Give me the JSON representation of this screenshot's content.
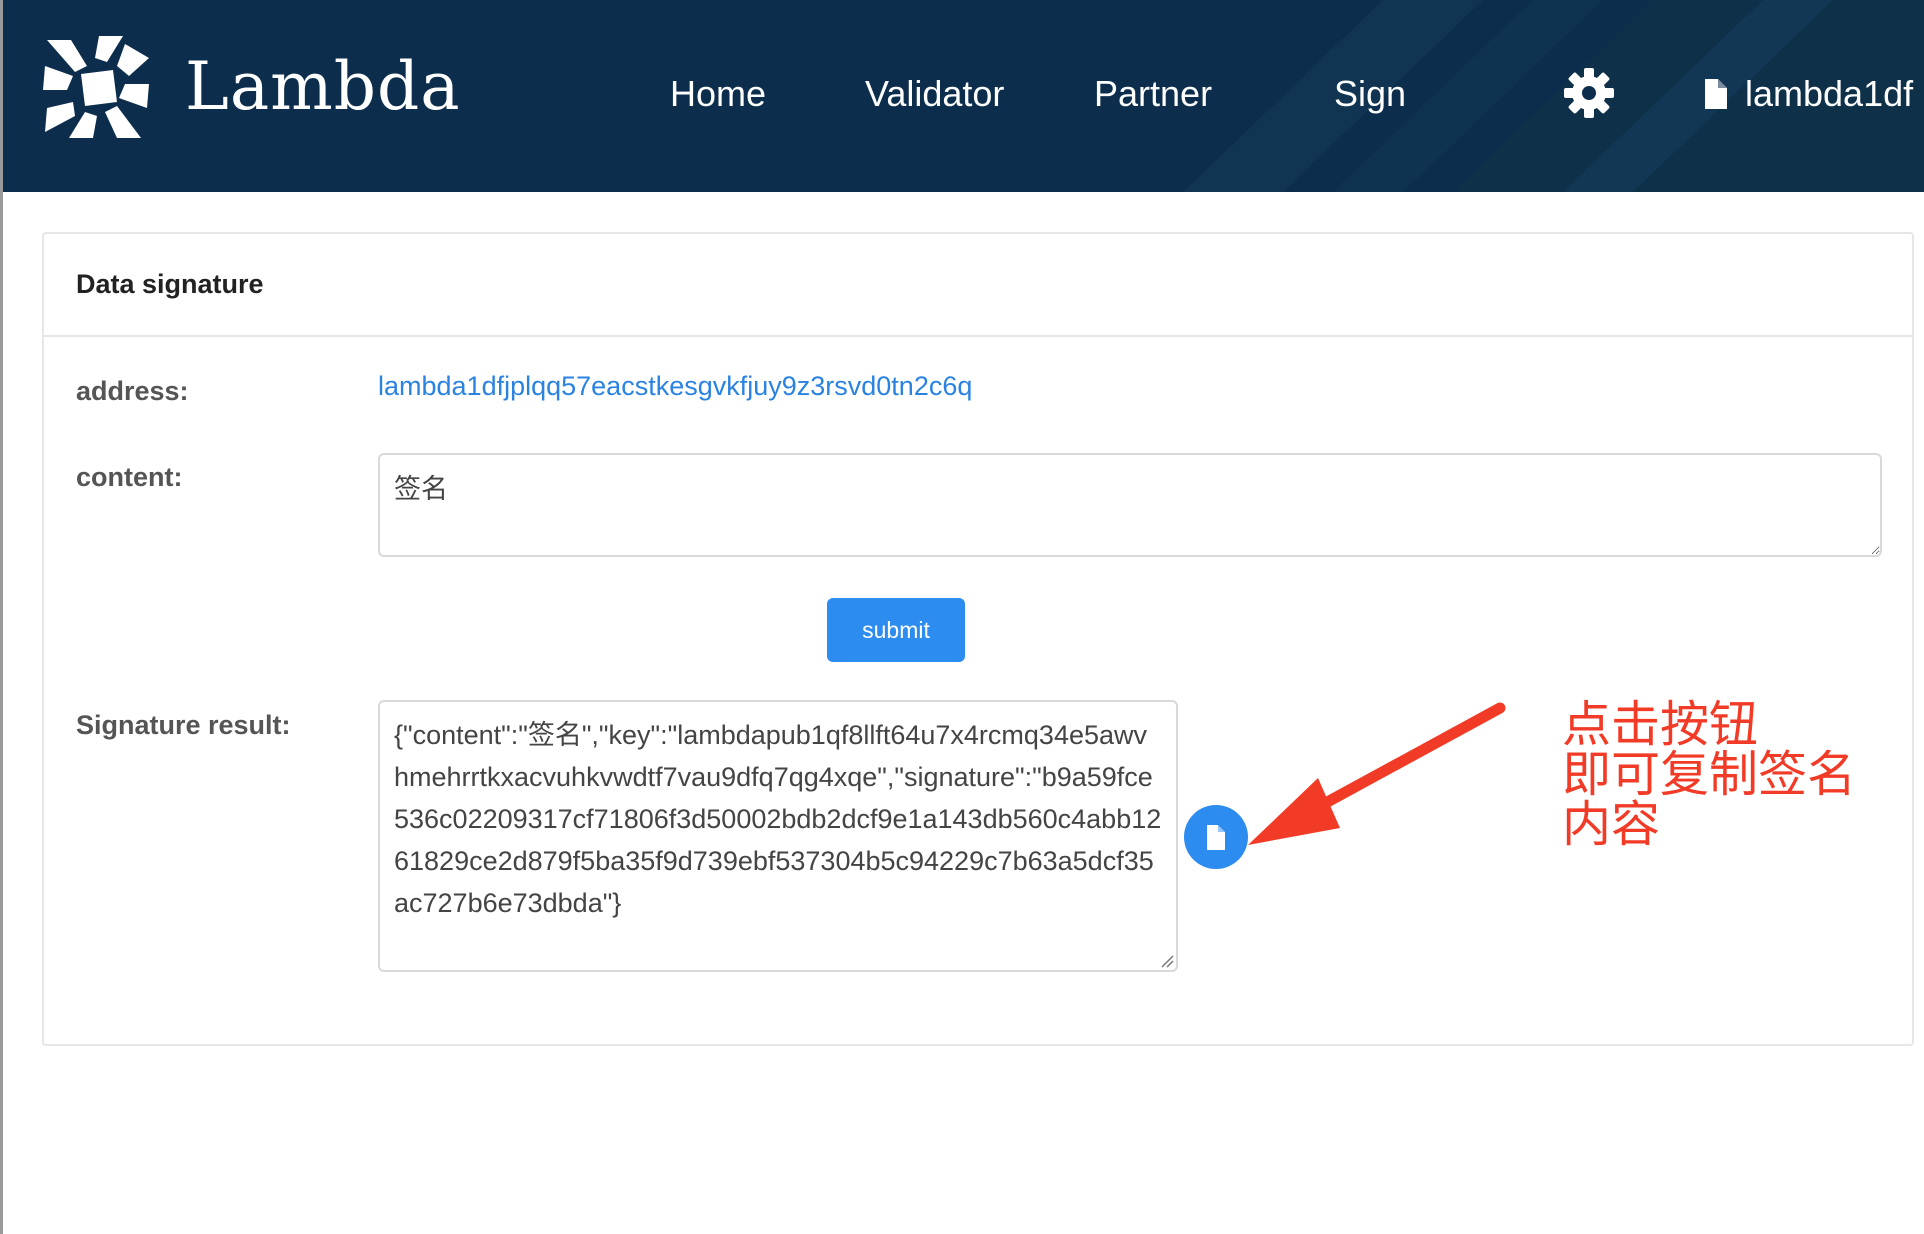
{
  "colors": {
    "navbar_bg": "#0c2e4c",
    "primary": "#2d8cf0",
    "link": "#2a83e0",
    "annotation": "#f23b27"
  },
  "header": {
    "brand": "Lambda",
    "nav": [
      "Home",
      "Validator",
      "Partner",
      "Sign"
    ],
    "settings_icon": "gear-icon",
    "account_icon": "document-icon",
    "account_label": "lambda1df"
  },
  "card": {
    "title": "Data signature",
    "address_label": "address:",
    "address_value": "lambda1dfjplqq57eacstkesgvkfjuy9z3rsvd0tn2c6q",
    "content_label": "content:",
    "content_value": "签名",
    "submit_label": "submit",
    "result_label": "Signature result:",
    "result_value": "{\"content\":\"签名\",\"key\":\"lambdapub1qf8llft64u7x4rcmq34e5awvhmehrrtkxacvuhkvwdtf7vau9dfq7qg4xqe\",\"signature\":\"b9a59fce536c02209317cf71806f3d50002bdb2dcf9e1a143db560c4abb1261829ce2d879f5ba35f9d739ebf537304b5c94229c7b63a5dcf35ac727b6e73dbda\"}",
    "copy_icon": "copy-icon"
  },
  "annotation": {
    "lines": [
      "点击按钮",
      "即可复制签名",
      "内容"
    ]
  }
}
